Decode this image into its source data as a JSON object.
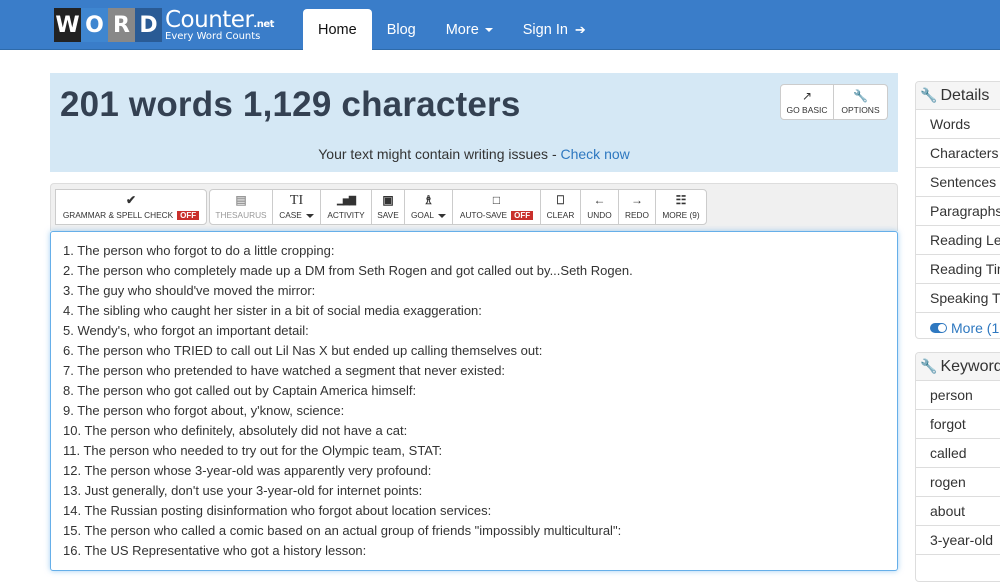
{
  "brand": {
    "letters": [
      "W",
      "O",
      "R",
      "D"
    ],
    "name": "Counter",
    "tld": ".net",
    "tagline": "Every Word Counts"
  },
  "nav": {
    "items": [
      {
        "label": "Home",
        "active": true
      },
      {
        "label": "Blog"
      },
      {
        "label": "More"
      },
      {
        "label": "Sign In"
      }
    ],
    "signin_icon": "➔"
  },
  "hero": {
    "title": "201 words 1,129 characters",
    "note": "Your text might contain writing issues - ",
    "note_link": "Check now",
    "go_basic_label": "GO BASIC",
    "options_label": "OPTIONS",
    "go_basic_icon": "↗",
    "options_icon": "🔧"
  },
  "toolbar": {
    "grammar": {
      "label": "GRAMMAR & SPELL CHECK",
      "badge": "OFF",
      "icon": "✔"
    },
    "thesaurus": {
      "label": "THESAURUS",
      "icon": "▤"
    },
    "case": {
      "label": "CASE",
      "icon": "TI"
    },
    "activity": {
      "label": "ACTIVITY",
      "icon": "▁▅▇"
    },
    "save": {
      "label": "SAVE",
      "icon": "▣"
    },
    "goal": {
      "label": "GOAL",
      "icon": "♗"
    },
    "autosave": {
      "label": "AUTO-SAVE",
      "badge": "OFF",
      "icon": "□"
    },
    "clear": {
      "label": "CLEAR",
      "icon": "⎕"
    },
    "undo": {
      "label": "UNDO",
      "icon": "←"
    },
    "redo": {
      "label": "REDO",
      "icon": "→"
    },
    "more": {
      "label": "MORE (9)",
      "icon": "☷"
    }
  },
  "editor": {
    "lines": [
      "1. The person who forgot to do a little cropping:",
      "2. The person who completely made up a DM from Seth Rogen and got called out by...Seth Rogen.",
      "3. The guy who should've moved the mirror:",
      "4. The sibling who caught her sister in a bit of social media exaggeration:",
      "5. Wendy's, who forgot an important detail:",
      "6. The person who TRIED to call out Lil Nas X but ended up calling themselves out:",
      "7. The person who pretended to have watched a segment that never existed:",
      "8. The person who got called out by Captain America himself:",
      "9. The person who forgot about, y'know, science:",
      "10. The person who definitely, absolutely did not have a cat:",
      "11. The person who needed to try out for the Olympic team, STAT:",
      "12. The person whose 3-year-old was apparently very profound:",
      "13. Just generally, don't use your 3-year-old for internet points:",
      "14. The Russian posting disinformation who forgot about location services:",
      "15. The person who called a comic based on an actual group of friends \"impossibly multicultural\":",
      "16. The US Representative who got a history lesson:"
    ]
  },
  "details": {
    "title": "Details",
    "rows": [
      "Words",
      "Characters",
      "Sentences",
      "Paragraphs",
      "Reading Level",
      "Reading Time",
      "Speaking Time"
    ],
    "more_label": "More (1"
  },
  "keywords": {
    "title": "Keywords",
    "rows": [
      "person",
      "forgot",
      "called",
      "rogen",
      "about",
      "3-year-old"
    ]
  }
}
